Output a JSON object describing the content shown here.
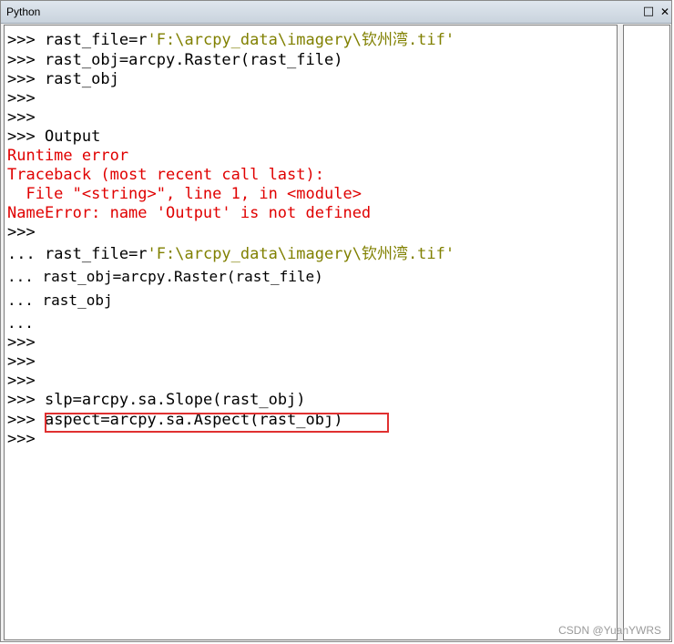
{
  "window": {
    "title": "Python",
    "maximize_glyph": "□",
    "close_glyph": "✕"
  },
  "console": {
    "lines": [
      {
        "prompt": ">>> ",
        "code": "rast_file=r",
        "str": "'F:\\arcpy_data\\imagery\\钦州湾.tif'"
      },
      {
        "prompt": ">>> ",
        "code": "rast_obj=arcpy.Raster(rast_file)"
      },
      {
        "prompt": ">>> ",
        "code": "rast_obj"
      },
      {
        "prompt": ">>>",
        "code": ""
      },
      {
        "prompt": ">>>",
        "code": ""
      },
      {
        "prompt": ">>> ",
        "code": "Output"
      },
      {
        "err": "Runtime error"
      },
      {
        "err": "Traceback (most recent call last):"
      },
      {
        "err": "  File \"<string>\", line 1, in <module>"
      },
      {
        "err": "NameError: name 'Output' is not defined"
      },
      {
        "prompt": ">>>",
        "code": ""
      },
      {
        "prompt": "... ",
        "code": "rast_file=r",
        "str": "'F:\\arcpy_data\\imagery\\钦州湾.tif'"
      },
      {
        "prompt": "... ",
        "code": "rast_obj=arcpy.Raster(rast_file)"
      },
      {
        "prompt": "... ",
        "code": "rast_obj"
      },
      {
        "prompt": "...",
        "code": ""
      },
      {
        "prompt": ">>>",
        "code": ""
      },
      {
        "prompt": ">>>",
        "code": ""
      },
      {
        "prompt": ">>>",
        "code": ""
      },
      {
        "prompt": ">>> ",
        "code": "slp=arcpy.sa.Slope(rast_obj)"
      },
      {
        "prompt": ">>> ",
        "code": "aspect=arcpy.sa.Aspect(rast_obj)"
      },
      {
        "prompt": ">>>",
        "code": ""
      }
    ]
  },
  "highlight_color": "#e03030",
  "watermark": "CSDN @YuanYWRS"
}
